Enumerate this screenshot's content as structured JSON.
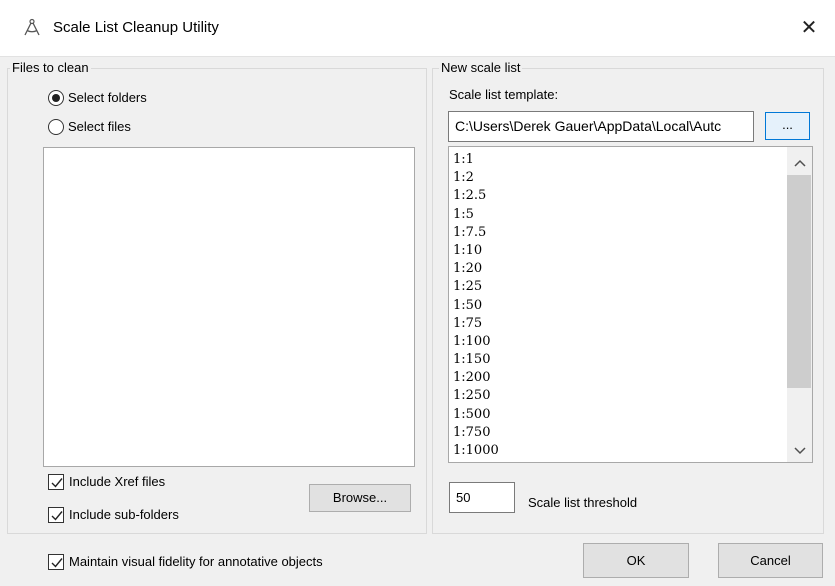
{
  "window": {
    "title": "Scale List Cleanup Utility",
    "close_glyph": "✕",
    "app_icon": "compass-icon"
  },
  "files_group": {
    "legend": "Files to clean",
    "radio_folders": {
      "label": "Select folders",
      "selected": true
    },
    "radio_files": {
      "label": "Select files",
      "selected": false
    },
    "include_xref": {
      "label": "Include Xref files",
      "checked": true
    },
    "include_subfolders": {
      "label": "Include sub-folders",
      "checked": true
    },
    "browse_label": "Browse..."
  },
  "scale_group": {
    "legend": "New scale list",
    "template_label": "Scale list template:",
    "template_path": "C:\\Users\\Derek Gauer\\AppData\\Local\\Autc",
    "ellipsis_label": "...",
    "scales": [
      "1:1",
      "1:2",
      "1:2.5",
      "1:5",
      "1:7.5",
      "1:10",
      "1:20",
      "1:25",
      "1:50",
      "1:75",
      "1:100",
      "1:150",
      "1:200",
      "1:250",
      "1:500",
      "1:750",
      "1:1000"
    ],
    "threshold_value": "50",
    "threshold_label": "Scale list threshold"
  },
  "footer": {
    "fidelity": {
      "label": "Maintain visual fidelity for annotative objects",
      "checked": true
    },
    "ok_label": "OK",
    "cancel_label": "Cancel"
  }
}
